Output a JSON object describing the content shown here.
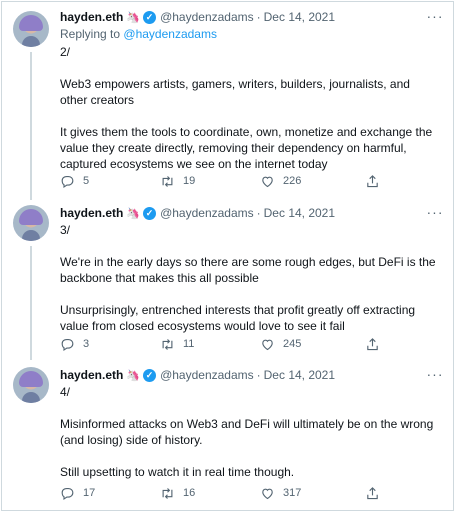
{
  "tweets": [
    {
      "author": {
        "name": "hayden.eth",
        "badge_emoji": "🦄",
        "handle": "@haydenzadams",
        "verified_icon": "verified-badge-icon",
        "avatar": "avatar-image"
      },
      "separator": "·",
      "date": "Dec 14, 2021",
      "replying": {
        "prefix": "Replying to",
        "link": "@haydenzadams"
      },
      "paragraphs": [
        "2/",
        "Web3 empowers artists, gamers, writers, builders, journalists, and other creators",
        "It gives them the tools to coordinate, own, monetize and exchange the value they create directly, removing their dependency on harmful, captured ecosystems we see on the internet today"
      ],
      "actions": {
        "replies": "5",
        "retweets": "19",
        "likes": "226"
      }
    },
    {
      "author": {
        "name": "hayden.eth",
        "badge_emoji": "🦄",
        "handle": "@haydenzadams",
        "verified_icon": "verified-badge-icon",
        "avatar": "avatar-image"
      },
      "separator": "·",
      "date": "Dec 14, 2021",
      "paragraphs": [
        "3/",
        "We're in the early days so there are some rough edges, but DeFi is the backbone that makes this all possible",
        "Unsurprisingly, entrenched interests that profit greatly off extracting value from closed ecosystems would love to see it fail"
      ],
      "actions": {
        "replies": "3",
        "retweets": "11",
        "likes": "245"
      }
    },
    {
      "author": {
        "name": "hayden.eth",
        "badge_emoji": "🦄",
        "handle": "@haydenzadams",
        "verified_icon": "verified-badge-icon",
        "avatar": "avatar-image"
      },
      "separator": "·",
      "date": "Dec 14, 2021",
      "paragraphs": [
        "4/",
        "Misinformed attacks on Web3 and DeFi will ultimately be on the wrong (and losing) side of history.",
        "Still upsetting to watch it in real time though."
      ],
      "actions": {
        "replies": "17",
        "retweets": "16",
        "likes": "317"
      }
    }
  ],
  "icons": {
    "more": "more-horizontal-icon",
    "reply": "reply-icon",
    "retweet": "retweet-icon",
    "like": "heart-icon",
    "share": "share-icon"
  },
  "colors": {
    "accent": "#1d9bf0",
    "text": "#0f1419",
    "muted": "#536471",
    "border": "#cfd9de"
  }
}
